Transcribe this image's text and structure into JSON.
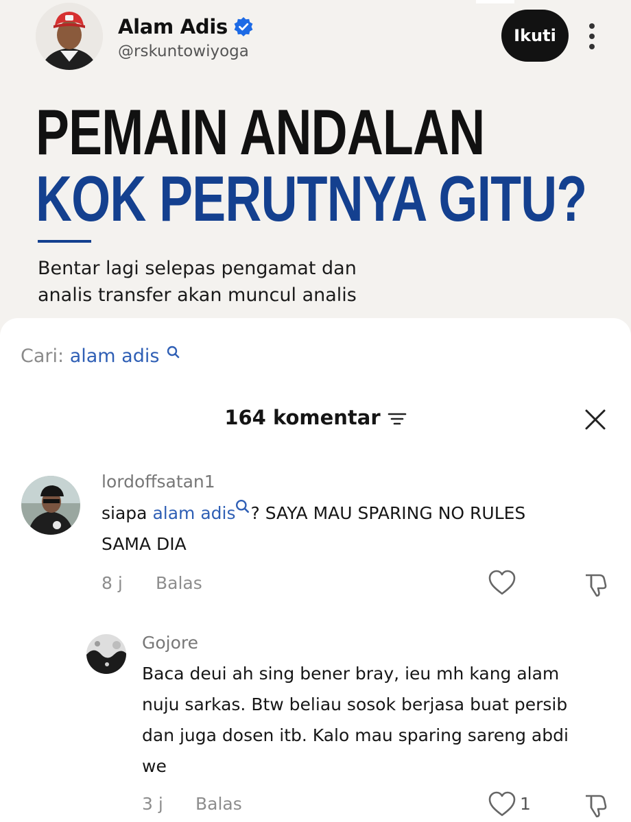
{
  "post": {
    "author_name": "Alam Adis",
    "author_handle": "@rskuntowiyoga",
    "follow_label": "Ikuti",
    "headline_line1": "PEMAIN ANDALAN",
    "headline_line2": "KOK PERUTNYA GITU?",
    "body_text": "Bentar lagi selepas pengamat dan analis transfer akan muncul analis",
    "icons": {
      "verified": "verified-badge-icon",
      "more": "more-vertical-icon"
    },
    "colors": {
      "headline_blue": "#14408f",
      "follow_bg": "#121212",
      "verified_blue": "#1d6ae5"
    }
  },
  "sheet": {
    "search_prefix": "Cari:",
    "search_term": "alam adis",
    "comment_count_label": "164 komentar",
    "icons": {
      "filter": "sort-filter-icon",
      "close": "close-icon",
      "search": "search-icon"
    },
    "colors": {
      "mention": "#2f5fb5"
    },
    "comments": [
      {
        "username": "lordoffsatan1",
        "text_before": "siapa ",
        "mention": "alam adis",
        "text_after": "? SAYA MAU SPARING NO RULES",
        "text_line2": "SAMA DIA",
        "time": "8 j",
        "reply_label": "Balas",
        "like_count": ""
      },
      {
        "username": "Gojore",
        "lines": [
          "Baca deui ah sing bener bray, ieu mh kang alam",
          "nuju sarkas. Btw beliau sosok berjasa buat persib",
          "dan juga dosen itb. Kalo mau sparing sareng abdi",
          "we"
        ],
        "time": "3 j",
        "reply_label": "Balas",
        "like_count": "1"
      }
    ]
  }
}
